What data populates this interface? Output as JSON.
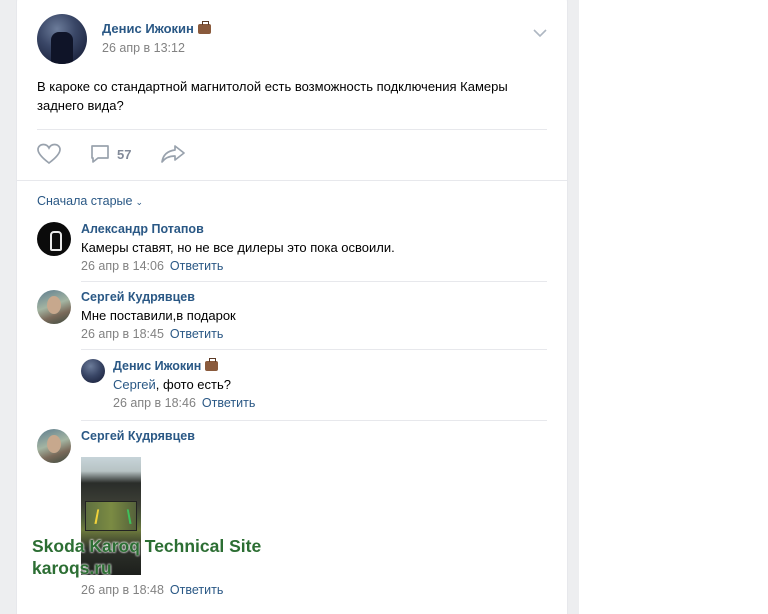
{
  "post": {
    "author": "Денис Ижокин",
    "date": "26 апр в 13:12",
    "text": "В кароке со стандартной магнитолой есть возможность подключения Камеры заднего вида?",
    "comment_count": "57"
  },
  "comments_sort": "Сначала старые",
  "reply_label": "Ответить",
  "comments": [
    {
      "author": "Александр Потапов",
      "text": "Камеры ставят, но не все дилеры это пока освоили.",
      "date": "26 апр в 14:06"
    },
    {
      "author": "Сергей Кудрявцев",
      "text": "Мне поставили,в подарок",
      "date": "26 апр в 18:45"
    },
    {
      "author": "Денис Ижокин",
      "reply_to": "Сергей",
      "text": ", фото есть?",
      "date": "26 апр в 18:46"
    },
    {
      "author": "Сергей Кудрявцев",
      "text": "",
      "date": "26 апр в 18:48"
    }
  ],
  "watermark": {
    "title": "Skoda Karoq Technical Site",
    "url": "karoqs.ru"
  },
  "colors": {
    "link": "#2a5885",
    "muted": "#828282",
    "divider": "#e7e8ec",
    "watermark": "#2c6e33"
  },
  "icons": [
    "heart-icon",
    "comment-icon",
    "share-icon",
    "chevron-down-icon",
    "briefcase-emoji-icon"
  ]
}
